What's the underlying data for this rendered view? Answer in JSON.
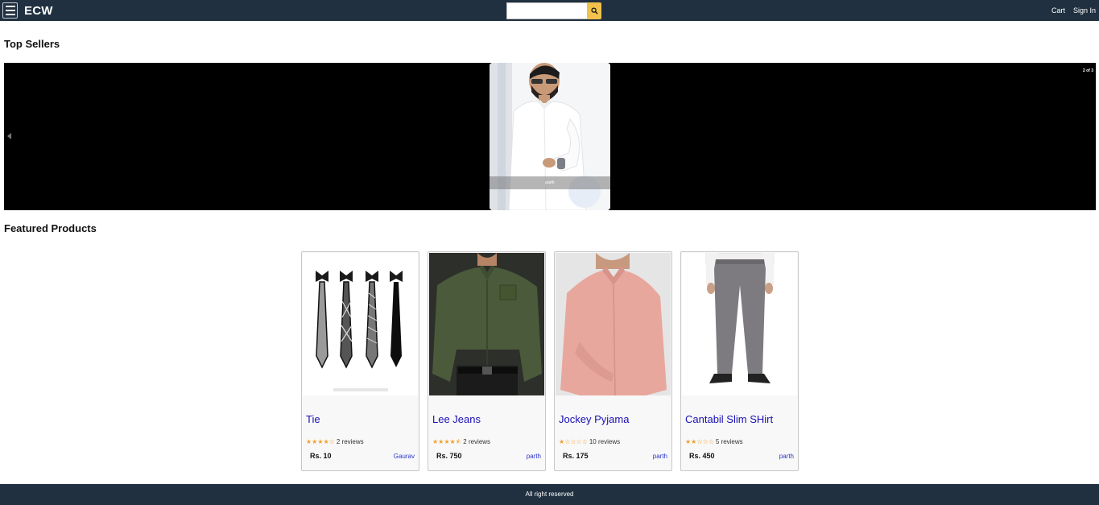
{
  "header": {
    "brand": "ECW",
    "search": {
      "value": "",
      "placeholder": ""
    },
    "links": {
      "cart": "Cart",
      "signin": "Sign In"
    }
  },
  "top_sellers": {
    "title": "Top Sellers",
    "status": "2 of 3",
    "slide": {
      "legend": "parth"
    }
  },
  "featured": {
    "title": "Featured Products",
    "products": [
      {
        "name": "Tie",
        "stars_filled": "★★★★",
        "stars_empty": "☆",
        "rating": 4,
        "reviews": "2 reviews",
        "price": "Rs. 10",
        "seller": "Gaurav",
        "image": "ties-image"
      },
      {
        "name": "Lee Jeans",
        "stars_filled": "★★★★",
        "stars_empty": "⯪",
        "rating": 4.5,
        "reviews": "2 reviews",
        "price": "Rs. 750",
        "seller": "parth",
        "image": "green-shirt-image"
      },
      {
        "name": "Jockey Pyjama",
        "stars_filled": "★",
        "stars_empty": "☆☆☆☆",
        "rating": 1,
        "reviews": "10 reviews",
        "price": "Rs. 175",
        "seller": "parth",
        "image": "pink-shirt-image"
      },
      {
        "name": "Cantabil Slim SHirt",
        "stars_filled": "★★",
        "stars_empty": "☆☆☆",
        "rating": 2,
        "reviews": "5 reviews",
        "price": "Rs. 450",
        "seller": "parth",
        "image": "grey-trousers-image"
      }
    ]
  },
  "footer": {
    "text": "All right reserved"
  },
  "colors": {
    "header_bg": "#203040",
    "accent": "#f0c14b",
    "link": "#1a10b5",
    "star": "#f0a030"
  }
}
